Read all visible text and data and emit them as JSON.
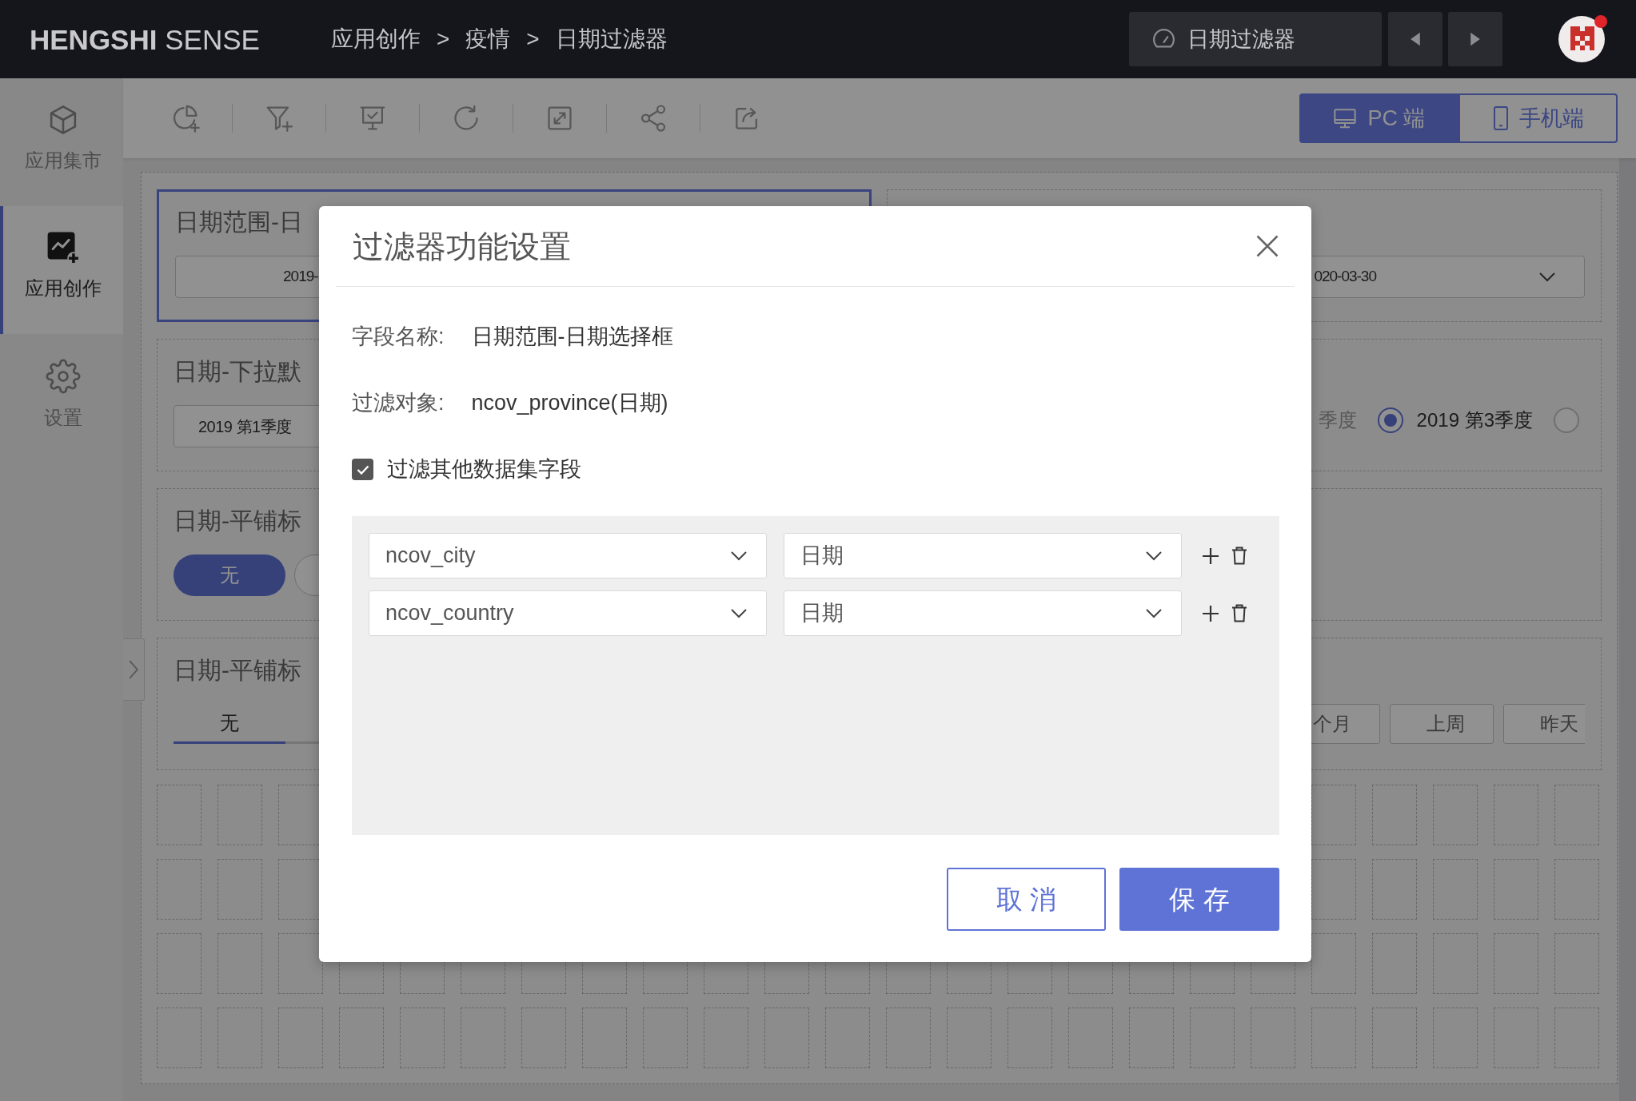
{
  "header": {
    "logo": "**HENGSHI** SENSE",
    "breadcrumb": {
      "items": [
        "应用创作",
        "疫情",
        "日期过滤器"
      ],
      "separator": ">"
    },
    "dashboard_selector": {
      "label": "日期过滤器"
    }
  },
  "sidebar": {
    "items": [
      {
        "label": "应用集市",
        "kind": "market",
        "selected": false
      },
      {
        "label": "应用创作",
        "kind": "create",
        "selected": true
      },
      {
        "label": "设置",
        "kind": "settings",
        "selected": false
      }
    ]
  },
  "view_switch": [
    {
      "label": "PC 端",
      "kind": "desktop",
      "selected": true
    },
    {
      "label": "手机端",
      "kind": "mobile",
      "selected": false
    }
  ],
  "canvas": {
    "left_widgets": [
      {
        "kind": "date_range",
        "title": "日期范围-日",
        "selected": true,
        "start": "2019-"
      },
      {
        "kind": "dropdown",
        "title": "日期-下拉默",
        "selected": false,
        "value": "2019 第1季度"
      },
      {
        "kind": "pills",
        "title": "日期-平铺标",
        "selected": false,
        "options": [
          {
            "label": "无",
            "selected": true
          },
          {
            "selected": false
          }
        ]
      },
      {
        "kind": "tabs",
        "title": "日期-平铺标",
        "selected": false,
        "options": [
          {
            "label": "无",
            "selected": true
          },
          {
            "selected": false
          }
        ]
      }
    ],
    "right_widgets": [
      {
        "kind": "date_range",
        "selected": false,
        "end": "020-03-30"
      },
      {
        "kind": "radios",
        "selected": false,
        "options": [
          {
            "label": "季度"
          },
          {
            "label": "2019 第3季度",
            "selected": true
          },
          {
            "selected": false
          }
        ]
      },
      {
        "kind": "empty",
        "selected": false
      },
      {
        "kind": "buttons",
        "selected": false,
        "options": [
          {
            "label": "个月",
            "selected": false
          },
          {
            "label": "上周",
            "selected": false
          },
          {
            "label": "昨天",
            "selected": false
          }
        ]
      }
    ]
  },
  "dialog": {
    "title": "过滤器功能设置",
    "info": [
      {
        "label": "字段名称:",
        "value": "日期范围-日期选择框"
      },
      {
        "label": "过滤对象:",
        "value": "ncov_province(日期)"
      }
    ],
    "filter_other": {
      "label": "过滤其他数据集字段",
      "checked": true
    },
    "mappings": [
      {
        "dataset": "ncov_city",
        "field": "日期"
      },
      {
        "dataset": "ncov_country",
        "field": "日期"
      }
    ],
    "buttons": [
      {
        "kind": "cancel",
        "label": "取 消"
      },
      {
        "kind": "save",
        "label": "保 存"
      }
    ]
  }
}
